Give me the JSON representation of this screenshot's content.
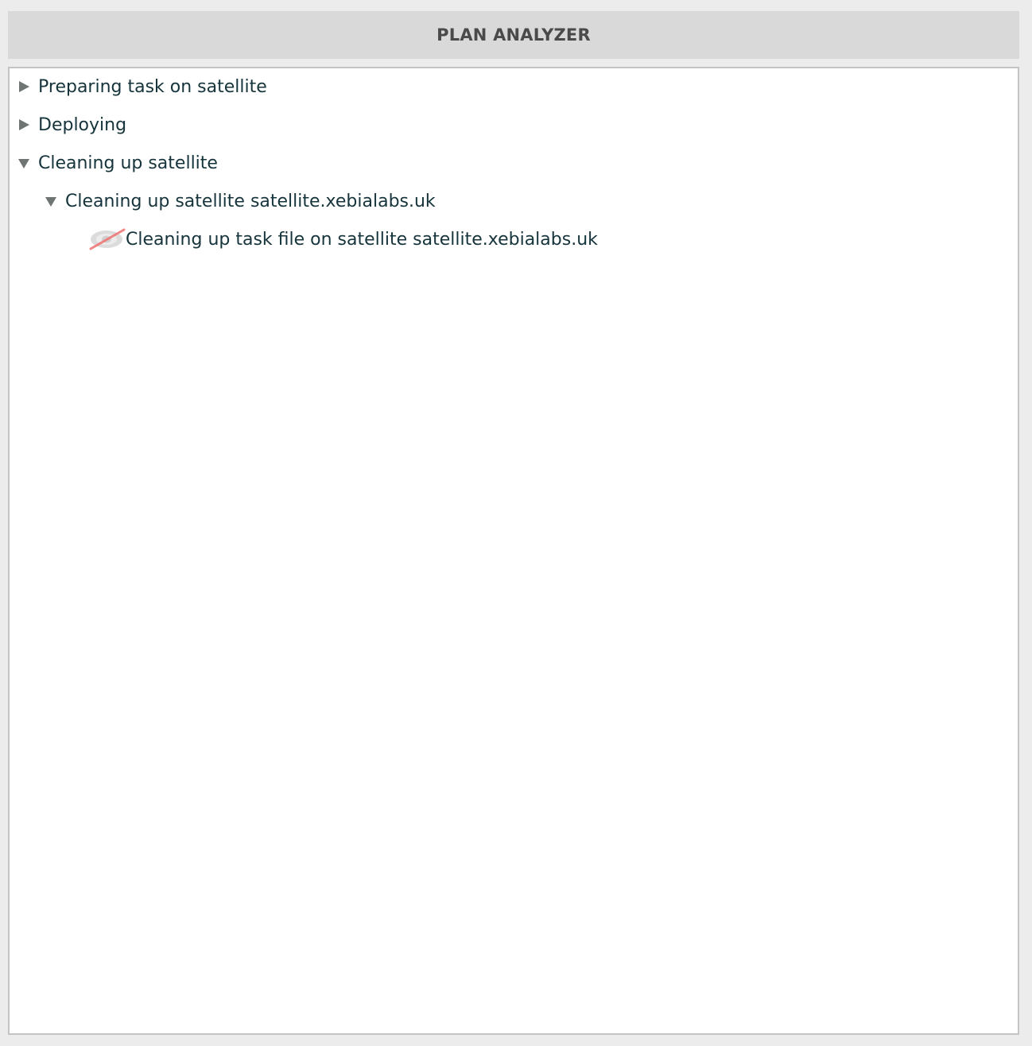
{
  "header": {
    "title": "PLAN ANALYZER"
  },
  "tree": {
    "items": [
      {
        "label": "Preparing task on satellite",
        "expanded": false,
        "toggle_icon": "triangle-right-icon"
      },
      {
        "label": "Deploying",
        "expanded": false,
        "toggle_icon": "triangle-right-icon"
      },
      {
        "label": "Cleaning up satellite",
        "expanded": true,
        "toggle_icon": "triangle-down-icon"
      }
    ],
    "subgroup": {
      "label": "Cleaning up satellite satellite.xebialabs.uk",
      "expanded": true,
      "toggle_icon": "triangle-down-icon"
    },
    "step": {
      "label": "Cleaning up task file on satellite satellite.xebialabs.uk",
      "status_icon": "skipped-eye-icon"
    }
  },
  "colors": {
    "header_bg": "#d9d9d9",
    "text": "#16343b",
    "toggle": "#6f7573",
    "skip_strike": "#f07070"
  }
}
